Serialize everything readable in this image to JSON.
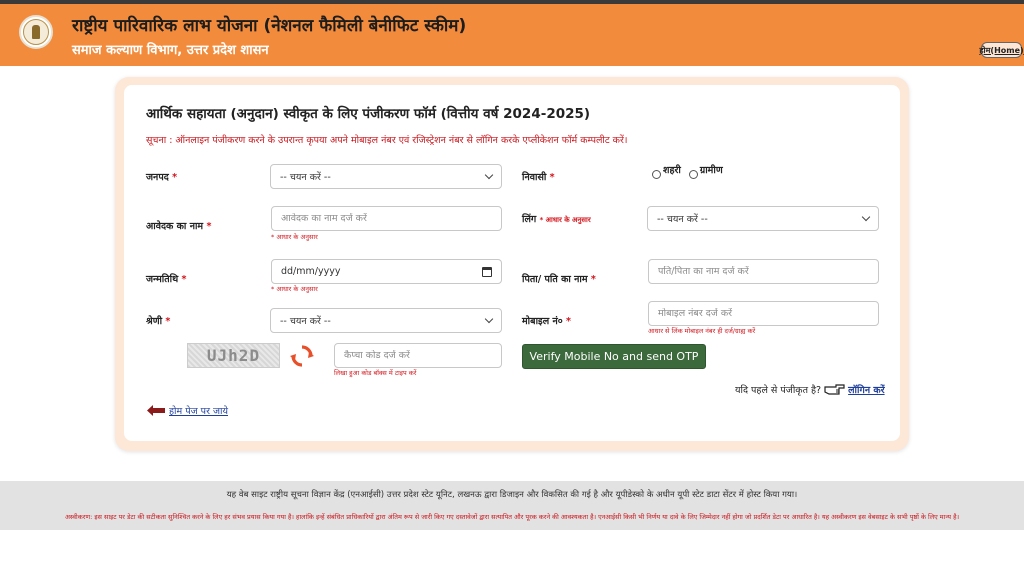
{
  "header": {
    "title": "राष्ट्रीय पारिवारिक लाभ योजना (नेशनल फैमिली बेनीफिट स्कीम)",
    "subtitle": "समाज कल्याण विभाग, उत्तर प्रदेश शासन",
    "home_label": "होम(Home)",
    "colors": {
      "header_bg": "#f28b3c",
      "verify_button": "#3c6a3c"
    }
  },
  "form": {
    "title": "आर्थिक सहायता (अनुदान) स्वीकृत के लिए पंजीकरण फॉर्म (वित्तीय वर्ष 2024-2025)",
    "notice": "सूचना : ऑनलाइन पंजीकरण करने के उपरान्त कृपया अपने मोबाइल नंबर एवं रजिस्ट्रेशन नंबर से लॉगिन करके एप्लीकेशन फॉर्म कम्पलीट करें।",
    "required_mark": "*",
    "district": {
      "label": "जनपद",
      "value": "-- चयन करें --"
    },
    "residence": {
      "label": "निवासी",
      "options": [
        "शहरी",
        "ग्रामीण"
      ]
    },
    "applicant_name": {
      "label": "आवेदक का नाम",
      "placeholder": "आवेदक का नाम दर्ज करें",
      "hint": "* आधार के अनुसार"
    },
    "gender": {
      "label": "लिंग",
      "label_note": "* आधार के अनुसार",
      "value": "-- चयन करें --"
    },
    "dob": {
      "label": "जन्मतिथि",
      "value": "dd/mm/yyyy",
      "hint": "* आधार के अनुसार"
    },
    "father_name": {
      "label": "पिता/ पति का नाम",
      "placeholder": "पति/पिता का नाम दर्ज करें"
    },
    "category": {
      "label": "श्रेणी",
      "value": "-- चयन करें --"
    },
    "mobile": {
      "label": "मोबाइल नं०",
      "placeholder": "मोबाइल नंबर दर्ज करें",
      "hint": "आधार से लिंक मोबाइल नंबर ही दर्ज/ग्राह्य करें"
    },
    "captcha": {
      "text": "UJh2D",
      "placeholder": "कैप्चा कोड दर्ज करें",
      "hint": "लिखा हुआ कोड बॉक्स में टाइप करें"
    },
    "verify_button": "Verify Mobile No and send OTP",
    "already_registered": "यदि पहले से पंजीकृत है?",
    "login_link": "लॉगिन करें",
    "back_home": "होम पेज पर जाये"
  },
  "footer": {
    "main": "यह वेब साइट राष्ट्रीय सूचना विज्ञान केंद्र (एनआईसी) उत्तर प्रदेश स्टेट यूनिट, लखनऊ द्वारा डिजाइन और विकसित की गई है और यूपीडेस्को के अधीन यूपी स्टेट डाटा सेंटर में होस्ट किया गया।",
    "disclaimer": "अस्वीकरण: इस साइट पर डेटा की सटीकता सुनिश्चित करने के लिए हर संभव प्रयास किया गया है। हालांकि इन्हें संबंधित प्राधिकारियों द्वारा अंतिम रूप से जारी किए गए दस्तावेजों द्वारा सत्यापित और पूरक करने की आवश्यकता है। एनआईसी किसी भी निर्णय या दावे के लिए जिम्मेदार नहीं होगा जो प्रदर्शित डेटा पर आधारित है। यह अस्वीकरण इस वेबसाइट के सभी पृष्ठों के लिए मान्य है।"
  }
}
